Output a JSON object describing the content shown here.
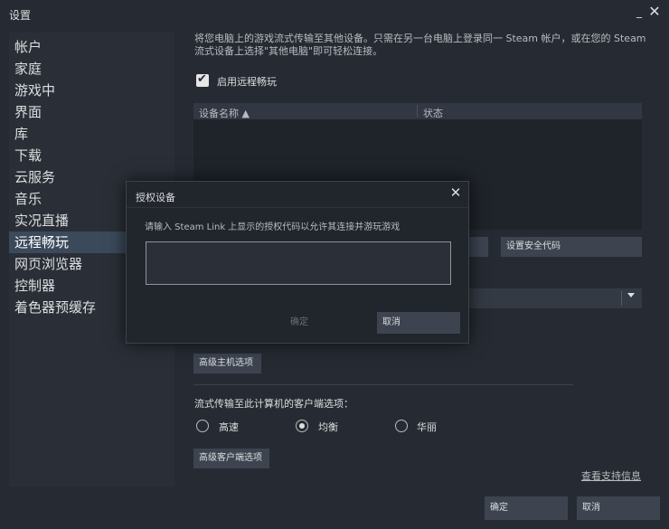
{
  "window": {
    "title": "设置",
    "minimize_glyph": "_",
    "close_glyph": "✕"
  },
  "sidebar": {
    "items": [
      {
        "label": "帐户"
      },
      {
        "label": "家庭"
      },
      {
        "label": "游戏中"
      },
      {
        "label": "界面"
      },
      {
        "label": "库"
      },
      {
        "label": "下载"
      },
      {
        "label": "云服务"
      },
      {
        "label": "音乐"
      },
      {
        "label": "实况直播"
      },
      {
        "label": "远程畅玩",
        "active": true
      },
      {
        "label": "网页浏览器"
      },
      {
        "label": "控制器"
      },
      {
        "label": "着色器预缓存"
      }
    ]
  },
  "remote_play": {
    "description": "将您电脑上的游戏流式传输至其他设备。只需在另一台电脑上登录同一 Steam 帐户，或在您的 Steam 流式设备上选择\"其他电脑\"即可轻松连接。",
    "enable_label": "启用远程畅玩",
    "enabled": true,
    "table": {
      "col_device": "设备名称 ▲",
      "col_status": "状态"
    },
    "set_security_code_label": "设置安全代码",
    "advanced_host_label": "高级主机选项",
    "client_options_label": "流式传输至此计算机的客户端选项：",
    "quality_options": [
      {
        "label": "高速",
        "selected": false
      },
      {
        "label": "均衡",
        "selected": true
      },
      {
        "label": "华丽",
        "selected": false
      }
    ],
    "advanced_client_label": "高级客户端选项",
    "support_link": "查看支持信息"
  },
  "footer": {
    "ok_label": "确定",
    "cancel_label": "取消"
  },
  "dialog": {
    "title": "授权设备",
    "close_glyph": "✕",
    "message": "请输入 Steam Link 上显示的授权代码以允许其连接并游玩游戏",
    "input_value": "",
    "input_placeholder": "",
    "ok_label": "确定",
    "cancel_label": "取消"
  }
}
